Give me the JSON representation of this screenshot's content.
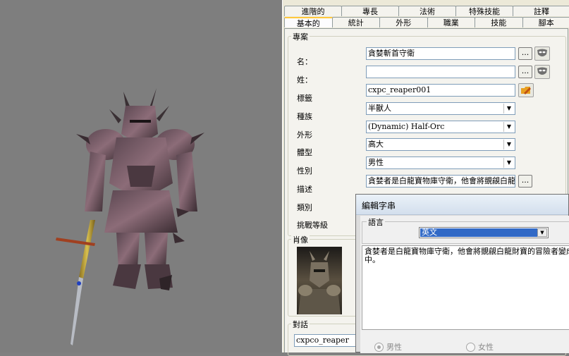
{
  "tabs_row1": [
    "進階的",
    "專長",
    "法術",
    "特殊技能",
    "註釋"
  ],
  "tabs_row2": [
    "基本的",
    "統計",
    "外形",
    "職業",
    "技能",
    "腳本"
  ],
  "profile": {
    "group_label": "專案",
    "name_label": "名：",
    "name_value": "貪婪斬首守衛",
    "surname_label": "姓：",
    "surname_value": "",
    "tag_label": "標籤",
    "tag_value": "cxpc_reaper001",
    "race_label": "種族",
    "race_value": "半獸人",
    "appearance_label": "外形",
    "appearance_value": "(Dynamic) Half-Orc",
    "body_label": "體型",
    "body_value": "高大",
    "gender_label": "性別",
    "gender_value": "男性",
    "desc_label": "描述",
    "desc_value": "貪婪者是白龍寶物庫守衛，他會將覬覦白龍",
    "category_label": "類別",
    "cr_label": "挑戰等級",
    "ellipsis": "..."
  },
  "portrait": {
    "group_label": "肖像"
  },
  "dialog_group": {
    "group_label": "對話",
    "value": "cxpco_reaper"
  },
  "edit_dialog": {
    "title": "編輯字串",
    "lang_group_label": "語言",
    "lang_value": "英文",
    "text": "貪婪者是白龍寶物庫守衛，他會將覬覦白龍財寶的冒險者變成殭屍，然後將他們的軀體裝進水晶棺材中。",
    "male_label": "男性",
    "female_label": "女性"
  },
  "colors": {
    "selection": "#3169c6",
    "folder": "#e8a020"
  }
}
